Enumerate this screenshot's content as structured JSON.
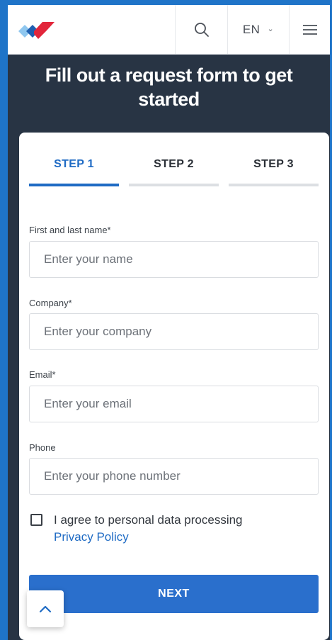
{
  "header": {
    "language": "EN",
    "icons": {
      "logo": "brand-logo",
      "search": "search-icon",
      "chevron": "chevron-down-icon",
      "menu": "menu-icon"
    }
  },
  "hero": {
    "title_line1": "Fill out a request form to get",
    "title_line2": "started"
  },
  "steps": [
    {
      "label": "STEP 1",
      "active": true
    },
    {
      "label": "STEP 2",
      "active": false
    },
    {
      "label": "STEP 3",
      "active": false
    }
  ],
  "form": {
    "name": {
      "label": "First and last name*",
      "placeholder": "Enter your name",
      "value": ""
    },
    "company": {
      "label": "Company*",
      "placeholder": "Enter your company",
      "value": ""
    },
    "email": {
      "label": "Email*",
      "placeholder": "Enter your email",
      "value": ""
    },
    "phone": {
      "label": "Phone",
      "placeholder": "Enter your phone number",
      "value": ""
    },
    "consent": {
      "text": "I agree to personal data processing",
      "link": "Privacy Policy",
      "checked": false
    },
    "next_label": "NEXT"
  },
  "colors": {
    "accent": "#1f6bc4",
    "button": "#2a6fcc",
    "hero_bg": "#283444",
    "logo_light": "#8fc7ef",
    "logo_blue": "#1f5fb0",
    "logo_red": "#e2263b"
  }
}
